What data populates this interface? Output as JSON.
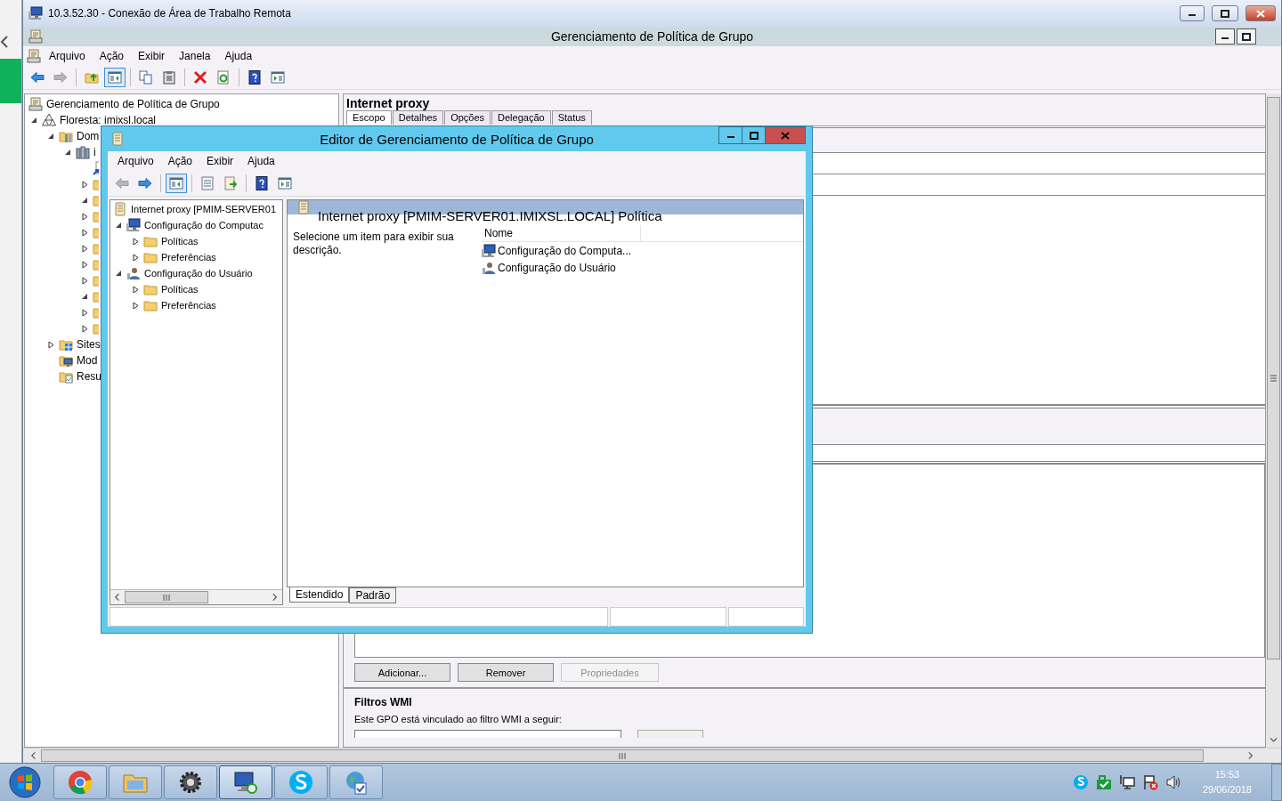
{
  "rdp_window": {
    "title": "10.3.52.30 - Conexão de Área de Trabalho Remota"
  },
  "app": {
    "title": "Gerenciamento de Política de Grupo",
    "menu": [
      "Arquivo",
      "Ação",
      "Exibir",
      "Janela",
      "Ajuda"
    ],
    "toolbar": [
      [
        {
          "kind": "back",
          "disabled": false,
          "pressed": false
        },
        {
          "kind": "forward",
          "disabled": true,
          "pressed": false
        }
      ],
      [
        {
          "kind": "up",
          "disabled": false,
          "pressed": false
        },
        {
          "kind": "console-tree",
          "disabled": false,
          "pressed": true
        }
      ],
      [
        {
          "kind": "copy",
          "disabled": false,
          "pressed": false
        },
        {
          "kind": "paste",
          "disabled": false,
          "pressed": false
        }
      ],
      [
        {
          "kind": "delete",
          "disabled": false,
          "pressed": false
        },
        {
          "kind": "refresh",
          "disabled": false,
          "pressed": false
        }
      ],
      [
        {
          "kind": "help",
          "disabled": false,
          "pressed": false
        },
        {
          "kind": "action-pane",
          "disabled": false,
          "pressed": false
        }
      ]
    ]
  },
  "tree": [
    {
      "label": "Gerenciamento de Política de Grupo",
      "kind": "console",
      "children": [
        {
          "label": "Floresta: imixsl.local",
          "kind": "forest",
          "expanded": true,
          "children": [
            {
              "label": "Dom",
              "kind": "domain",
              "expanded": true,
              "children": [
                {
                  "label": "i",
                  "kind": "server",
                  "expanded": true,
                  "children": [
                    {
                      "kind": "link"
                    },
                    {
                      "kind": "folder",
                      "expanded": false
                    },
                    {
                      "kind": "folder",
                      "expanded": true
                    },
                    {
                      "kind": "folder",
                      "expanded": false
                    },
                    {
                      "kind": "folder",
                      "expanded": false
                    },
                    {
                      "kind": "folder",
                      "expanded": false
                    },
                    {
                      "kind": "folder",
                      "expanded": false
                    },
                    {
                      "kind": "folder",
                      "expanded": false
                    },
                    {
                      "kind": "folder",
                      "expanded": true
                    },
                    {
                      "kind": "folder",
                      "expanded": false
                    },
                    {
                      "kind": "folder",
                      "expanded": false
                    }
                  ]
                }
              ]
            },
            {
              "label": "Sites",
              "kind": "sites",
              "expanded": false
            },
            {
              "label": "Mod",
              "kind": "modeling"
            },
            {
              "label": "Resu",
              "kind": "results"
            }
          ]
        }
      ]
    }
  ],
  "details": {
    "title": "Internet proxy",
    "tabs": [
      {
        "label": "Escopo",
        "selected": true
      },
      {
        "label": "Detalhes",
        "selected": false
      },
      {
        "label": "Opções",
        "selected": false
      },
      {
        "label": "Delegação",
        "selected": false
      },
      {
        "label": "Status",
        "selected": false
      }
    ],
    "buttons": [
      {
        "label": "Adicionar...",
        "disabled": false
      },
      {
        "label": "Remover",
        "disabled": false
      },
      {
        "label": "Propriedades",
        "disabled": true
      }
    ],
    "wmi": {
      "title": "Filtros WMI",
      "text": "Este GPO está vinculado ao filtro WMI a seguir:"
    }
  },
  "editor": {
    "title": "Editor de Gerenciamento de Política de Grupo",
    "menu": [
      "Arquivo",
      "Ação",
      "Exibir",
      "Ajuda"
    ],
    "toolbar": [
      [
        {
          "kind": "back",
          "disabled": true,
          "pressed": false
        },
        {
          "kind": "forward",
          "disabled": false,
          "pressed": false
        }
      ],
      [
        {
          "kind": "console-tree",
          "disabled": false,
          "pressed": true
        }
      ],
      [
        {
          "kind": "properties",
          "disabled": false,
          "pressed": false
        },
        {
          "kind": "export",
          "disabled": false,
          "pressed": false
        }
      ],
      [
        {
          "kind": "help",
          "disabled": false,
          "pressed": false
        },
        {
          "kind": "action-pane",
          "disabled": false,
          "pressed": false
        }
      ]
    ],
    "tree": [
      {
        "label": "Internet proxy [PMIM-SERVER01",
        "kind": "gpo",
        "children": [
          {
            "label": "Configuração do Computac",
            "kind": "computer",
            "expanded": true,
            "children": [
              {
                "label": "Políticas",
                "kind": "folder",
                "expanded": false
              },
              {
                "label": "Preferências",
                "kind": "folder",
                "expanded": false
              }
            ]
          },
          {
            "label": "Configuração do Usuário",
            "kind": "user",
            "expanded": true,
            "children": [
              {
                "label": "Políticas",
                "kind": "folder",
                "expanded": false
              },
              {
                "label": "Preferências",
                "kind": "folder",
                "expanded": false
              }
            ]
          }
        ]
      }
    ],
    "header": "Internet proxy [PMIM-SERVER01.IMIXSL.LOCAL] Política",
    "description": "Selecione um item para exibir sua descrição.",
    "columns": [
      "Nome"
    ],
    "items": [
      {
        "label": "Configuração do Computa...",
        "kind": "computer"
      },
      {
        "label": "Configuração do Usuário",
        "kind": "user"
      }
    ],
    "view_tabs": [
      {
        "label": "Estendido",
        "selected": true
      },
      {
        "label": "Padrão",
        "selected": false
      }
    ]
  },
  "taskbar": {
    "apps": [
      {
        "kind": "chrome",
        "active": false
      },
      {
        "kind": "explorer",
        "active": false
      },
      {
        "kind": "settings",
        "active": false
      },
      {
        "kind": "remote-desktop",
        "active": true
      },
      {
        "kind": "skype",
        "active": false
      },
      {
        "kind": "web-app",
        "active": false
      }
    ],
    "tray": [
      {
        "kind": "skype"
      },
      {
        "kind": "network-ok"
      },
      {
        "kind": "network"
      },
      {
        "kind": "flag-error"
      },
      {
        "kind": "speaker"
      }
    ],
    "time": "15:53",
    "date": "29/06/2018"
  }
}
